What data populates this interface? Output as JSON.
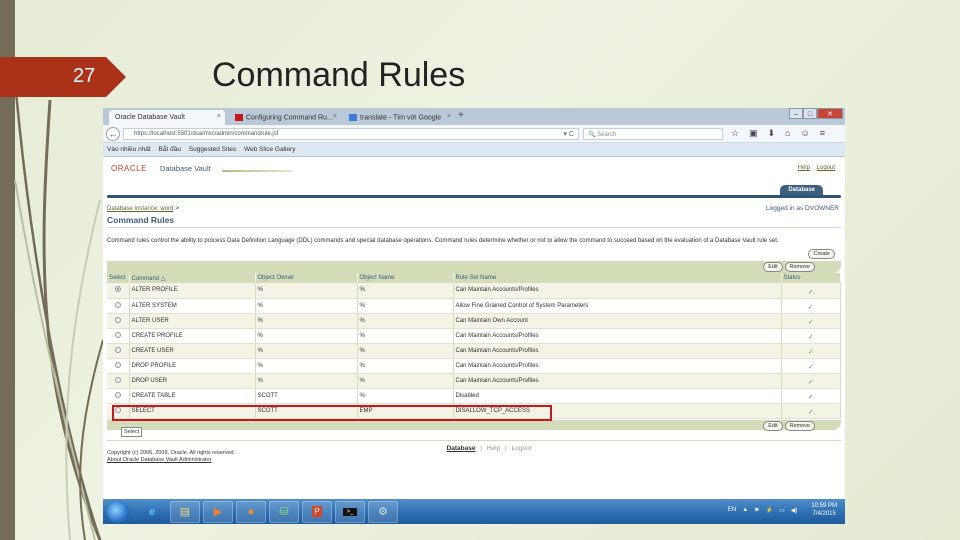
{
  "slide": {
    "number": "27",
    "title": "Command Rules"
  },
  "browser": {
    "tabs": [
      {
        "label": "Oracle Database Vault",
        "active": true
      },
      {
        "label": "Configuring Command Ru...",
        "active": false
      },
      {
        "label": "translate - Tìm với Google",
        "active": false
      }
    ],
    "new_tab": "+",
    "window_controls": {
      "minimize": "–",
      "maximize": "□",
      "close": "✕"
    },
    "back": "←",
    "url": "https://localhost:5501/dva/mvc/admin/commandrule.jsf",
    "reload": "▾ C",
    "search_placeholder": "Search",
    "toolbar_icons": [
      "☆",
      "▣",
      "⬇",
      "⌂",
      "☺",
      "≡"
    ],
    "bookmarks": [
      "Vào nhiều nhất",
      "Bắt đầu",
      "Suggested Sites",
      "Web Slice Gallery"
    ]
  },
  "app": {
    "brand": "ORACLE",
    "product": "Database Vault",
    "top_links": [
      "Help",
      "Logout"
    ],
    "active_tab": "Database",
    "breadcrumb": "Database Instance: word",
    "breadcrumb_sep": ">",
    "logged_in": "Logged in as DVOWNER",
    "page_title": "Command Rules",
    "description": "Command rules control the ability to process Data Definition Language (DDL) commands and special database operations. Command rules determine whether or not to allow the command to succeed based on the evaluation of a Database Vault rule set.",
    "buttons": {
      "create": "Create",
      "edit": "Edit",
      "remove": "Remove"
    },
    "table": {
      "columns": [
        "Select",
        "Command △",
        "Object Owner",
        "Object Name",
        "Rule Set Name",
        "Status"
      ],
      "rows": [
        {
          "selected": true,
          "command": "ALTER PROFILE",
          "owner": "%",
          "object": "%",
          "rule_set": "Can Maintain Accounts/Profiles",
          "status": "✓"
        },
        {
          "selected": false,
          "command": "ALTER SYSTEM",
          "owner": "%",
          "object": "%",
          "rule_set": "Allow Fine Grained Control of System Parameters",
          "status": "✓"
        },
        {
          "selected": false,
          "command": "ALTER USER",
          "owner": "%",
          "object": "%",
          "rule_set": "Can Maintain Own Account",
          "status": "✓"
        },
        {
          "selected": false,
          "command": "CREATE PROFILE",
          "owner": "%",
          "object": "%",
          "rule_set": "Can Maintain Accounts/Profiles",
          "status": "✓"
        },
        {
          "selected": false,
          "command": "CREATE USER",
          "owner": "%",
          "object": "%",
          "rule_set": "Can Maintain Accounts/Profiles",
          "status": "✓"
        },
        {
          "selected": false,
          "command": "DROP PROFILE",
          "owner": "%",
          "object": "%",
          "rule_set": "Can Maintain Accounts/Profiles",
          "status": "✓"
        },
        {
          "selected": false,
          "command": "DROP USER",
          "owner": "%",
          "object": "%",
          "rule_set": "Can Maintain Accounts/Profiles",
          "status": "✓"
        },
        {
          "selected": false,
          "command": "CREATE TABLE",
          "owner": "SCOTT",
          "object": "%",
          "rule_set": "Disabled",
          "status": "✓"
        },
        {
          "selected": false,
          "command": "SELECT",
          "owner": "SCOTT",
          "object": "EMP",
          "rule_set": "DISALLOW_TCP_ACCESS",
          "status": "✓"
        }
      ]
    },
    "tooltip": "Select",
    "footer_links": [
      "Database",
      "Help",
      "Logout"
    ],
    "copyright": "Copyright (c) 2006, 2009, Oracle. All rights reserved.",
    "about": "About Oracle Database Vault Administrator"
  },
  "taskbar": {
    "apps": [
      "ie-icon",
      "explorer-icon",
      "media-icon",
      "firefox-icon",
      "database-icon",
      "powerpoint-icon",
      "cmd-icon",
      "network-icon"
    ],
    "lang": "EN",
    "time": "10:59 PM",
    "date": "7/4/2015"
  }
}
